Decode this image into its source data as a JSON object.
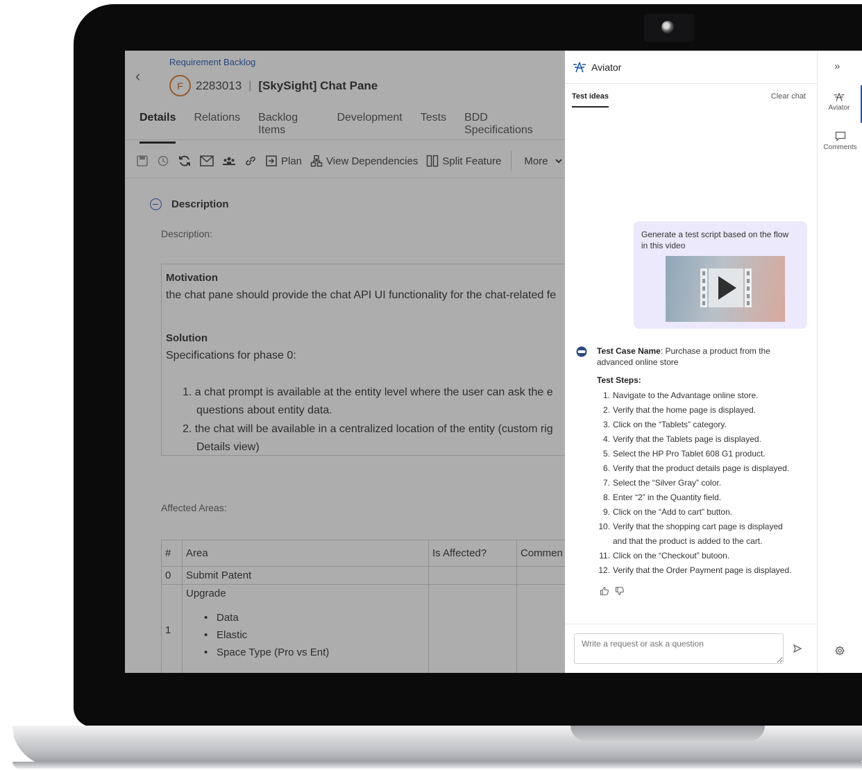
{
  "breadcrumb": "Requirement Backlog",
  "entity": {
    "type_letter": "F",
    "id": "2283013",
    "separator": "|",
    "title": "[SkySight] Chat Pane"
  },
  "tabs": [
    "Details",
    "Relations",
    "Backlog Items",
    "Development",
    "Tests",
    "BDD Specifications"
  ],
  "toolbar": {
    "plan": "Plan",
    "view_dependencies": "View Dependencies",
    "split_feature": "Split Feature",
    "more": "More"
  },
  "section": {
    "title": "Description",
    "description_label": "Description:"
  },
  "description": {
    "motivation_heading": "Motivation",
    "motivation_text": "the chat pane should provide the chat API UI functionality for the chat-related fe",
    "solution_heading": "Solution",
    "solution_text": "Specifications for phase 0:",
    "items": [
      {
        "num": "1.",
        "line1": "a chat prompt is available at the entity level where the user can ask the e",
        "line2": "questions about entity data."
      },
      {
        "num": "2.",
        "line1": "the chat will be available in a centralized location of the entity (custom rig",
        "line2": "Details view)"
      }
    ]
  },
  "affected": {
    "label": "Affected Areas:",
    "headers": [
      "#",
      "Area",
      "Is Affected?",
      "Commen"
    ],
    "rows": [
      {
        "num": "0",
        "area": "Submit Patent"
      },
      {
        "num": "1",
        "area": "Upgrade",
        "bullets": [
          "Data",
          "Elastic",
          "Space Type (Pro vs Ent)"
        ]
      }
    ]
  },
  "aviator": {
    "title": "Aviator",
    "subtab": "Test ideas",
    "clear_chat": "Clear chat",
    "user_message": "Generate a test script based on the flow in this video",
    "answer_name_label": "Test Case Name",
    "answer_name_value": ": Purchase a product from the advanced online store",
    "steps_label": "Test Steps:",
    "steps": [
      {
        "num": "1.",
        "text": "Navigate to the Advantage online store."
      },
      {
        "num": "2.",
        "text": "Verify that the home page is displayed."
      },
      {
        "num": "3.",
        "text": "Click on the “Tablets” category."
      },
      {
        "num": "4.",
        "text": "Verify that the Tablets page is displayed."
      },
      {
        "num": "5.",
        "text": "Select the HP Pro Tablet 608 G1 product."
      },
      {
        "num": "6.",
        "text": "Verify that the product details page is displayed."
      },
      {
        "num": "7.",
        "text": "Select the “Silver Gray” color."
      },
      {
        "num": "8.",
        "text": "Enter “2” in the Quantity field."
      },
      {
        "num": "9.",
        "text": "Click on the “Add to cart” button."
      },
      {
        "num": "10.",
        "text": "Verify that the shopping cart page is displayed"
      },
      {
        "num": "",
        "text": "and that the product is added to the cart."
      },
      {
        "num": "11.",
        "text": "Click on the “Checkout” butoon."
      },
      {
        "num": "12.",
        "text": "Verify that the Order Payment page is displayed."
      }
    ],
    "input_placeholder": "Write a request or ask a question"
  },
  "rail": {
    "collapse": "»",
    "aviator": "Aviator",
    "comments": "Comments"
  },
  "colors": {
    "accent": "#1a4ea8",
    "badge": "#d6741f",
    "user_bubble": "#ebe9fb",
    "bezel": "#0b0b0c"
  },
  "icons": [
    "back-arrow-icon",
    "save-icon",
    "history-icon",
    "refresh-icon",
    "mail-icon",
    "team-icon",
    "link-icon",
    "plan-icon",
    "dependencies-icon",
    "split-icon",
    "chevron-down-icon",
    "collapse-icon",
    "aviator-logo-icon",
    "bot-icon",
    "thumbs-up-icon",
    "thumbs-down-icon",
    "send-icon",
    "comment-icon",
    "settings-icon",
    "video-play-icon"
  ]
}
